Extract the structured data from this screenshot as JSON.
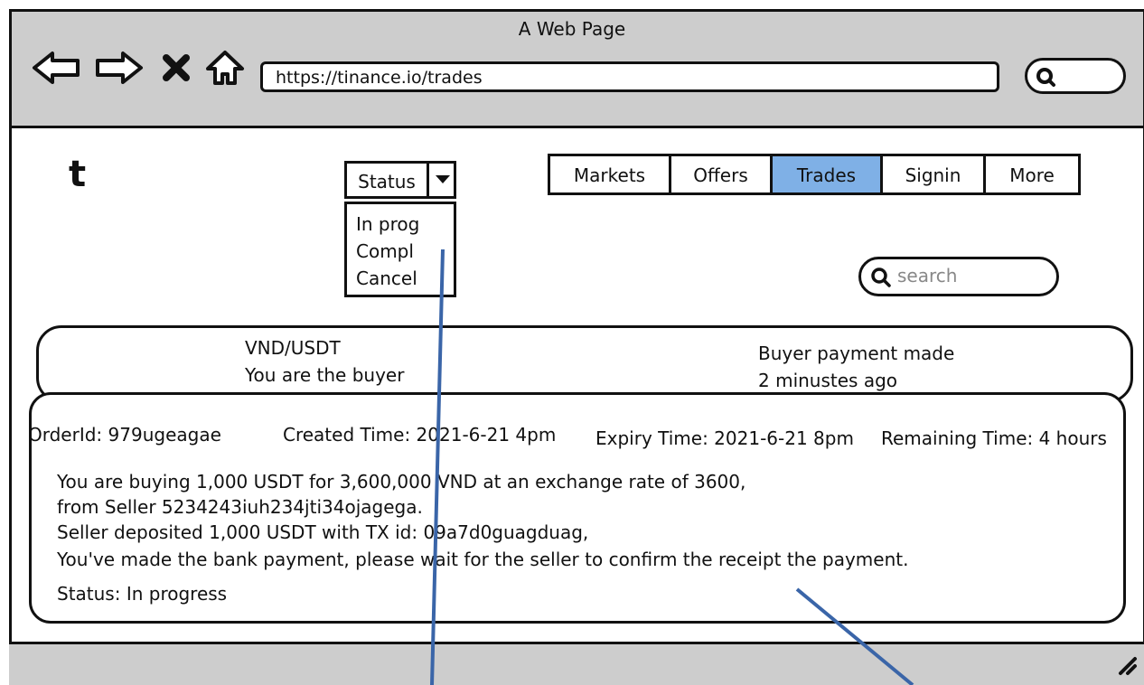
{
  "window": {
    "title": "A Web Page"
  },
  "toolbar": {
    "url": "https://tinance.io/trades",
    "icons": [
      "back-arrow-icon",
      "forward-arrow-icon",
      "stop-icon",
      "home-icon",
      "search-icon"
    ]
  },
  "logo": {
    "text": "t"
  },
  "status_filter": {
    "selected": "Status",
    "options": [
      "In prog",
      "Compl",
      "Cancel"
    ]
  },
  "nav": {
    "tabs": [
      {
        "label": "Markets"
      },
      {
        "label": "Offers"
      },
      {
        "label": "Trades",
        "active": true
      },
      {
        "label": "Signin"
      },
      {
        "label": "More"
      }
    ],
    "active_color": "#7fb0e6"
  },
  "search": {
    "placeholder": "search"
  },
  "trade_summary": {
    "pair": "VND/USDT",
    "role": "You are the buyer",
    "event": "Buyer payment made",
    "time": "2 minustes ago"
  },
  "trade_detail": {
    "order_id": "OrderId: 979ugeagae",
    "created": "Created Time: 2021-6-21 4pm",
    "expiry": "Expiry Time: 2021-6-21 8pm",
    "remaining": "Remaining Time: 4 hours",
    "lines": [
      "You are buying 1,000 USDT for 3,600,000 VND at an exchange rate of 3600,",
      "from Seller 5234243iuh234jti34ojagega.",
      "Seller deposited 1,000 USDT with TX id: 09a7d0guagduag,",
      "You've made the bank payment, please wait for the seller to confirm the receipt the payment."
    ],
    "status": "Status: In progress"
  },
  "annotation_color": "#3a65a8"
}
